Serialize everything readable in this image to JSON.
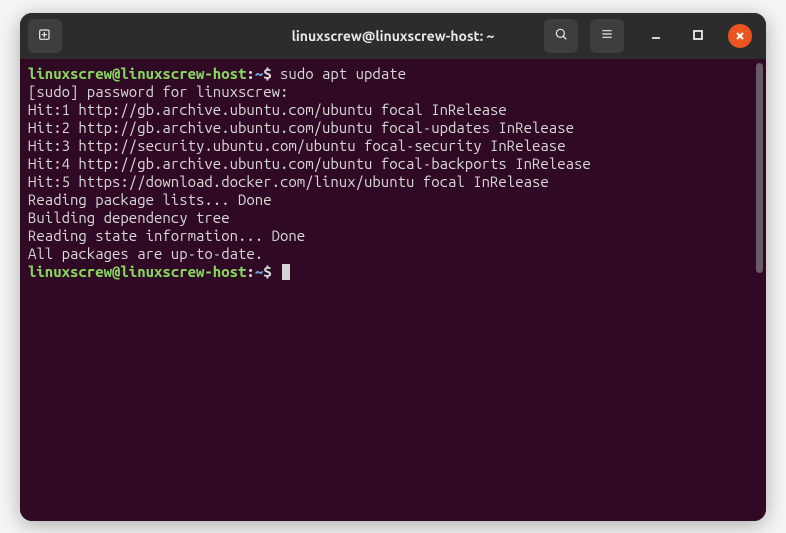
{
  "window": {
    "title": "linuxscrew@linuxscrew-host: ~"
  },
  "prompt": {
    "user_host": "linuxscrew@linuxscrew-host",
    "path": "~",
    "symbol": "$"
  },
  "session": {
    "command1": "sudo apt update",
    "lines": [
      "[sudo] password for linuxscrew:",
      "Hit:1 http://gb.archive.ubuntu.com/ubuntu focal InRelease",
      "Hit:2 http://gb.archive.ubuntu.com/ubuntu focal-updates InRelease",
      "Hit:3 http://security.ubuntu.com/ubuntu focal-security InRelease",
      "Hit:4 http://gb.archive.ubuntu.com/ubuntu focal-backports InRelease",
      "Hit:5 https://download.docker.com/linux/ubuntu focal InRelease",
      "Reading package lists... Done",
      "Building dependency tree",
      "Reading state information... Done",
      "All packages are up-to-date."
    ]
  },
  "icons": {
    "new_tab": "new-tab",
    "search": "search",
    "menu": "menu",
    "minimize": "minimize",
    "maximize": "maximize",
    "close": "close"
  }
}
